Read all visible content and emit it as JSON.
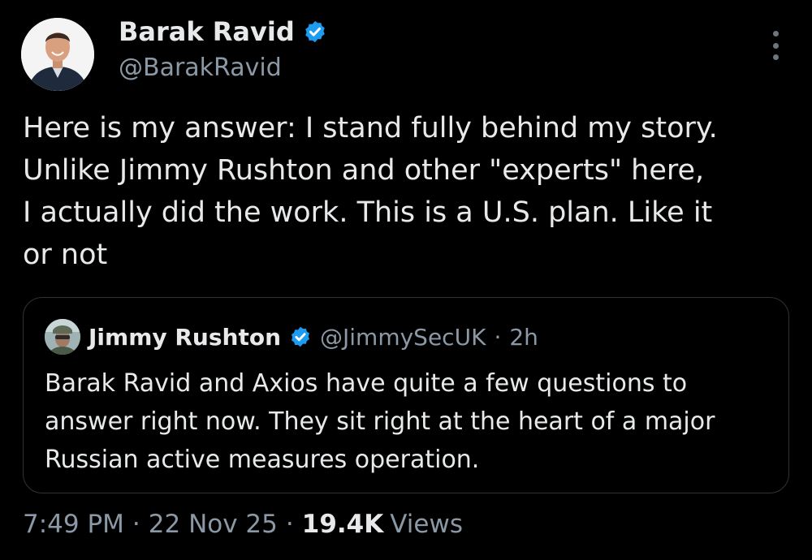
{
  "author": {
    "name": "Barak Ravid",
    "handle": "@BarakRavid",
    "verified": true
  },
  "tweet_text": "Here is my answer: I stand fully behind my story.\nUnlike Jimmy Rushton and other \"experts\" here,\nI actually did the work. This is a U.S. plan. Like it\nor not",
  "quoted_tweet": {
    "author_name": "Jimmy Rushton",
    "handle": "@JimmySecUK",
    "age": "2h",
    "text": "Barak Ravid and Axios have quite a few questions to\nanswer right now. They sit right at the heart of a major\nRussian active measures operation."
  },
  "meta": {
    "time": "7:49 PM",
    "date": "22 Nov 25",
    "views_count": "19.4K",
    "views_label": "Views",
    "separator": "·"
  },
  "icons": {
    "verified": "verified-badge-icon",
    "more": "more-options-icon"
  },
  "colors": {
    "background": "#000000",
    "text": "#e7e9ea",
    "muted": "#8b98a5",
    "verified_badge": "#1d9bf0",
    "border": "#2f3336"
  }
}
